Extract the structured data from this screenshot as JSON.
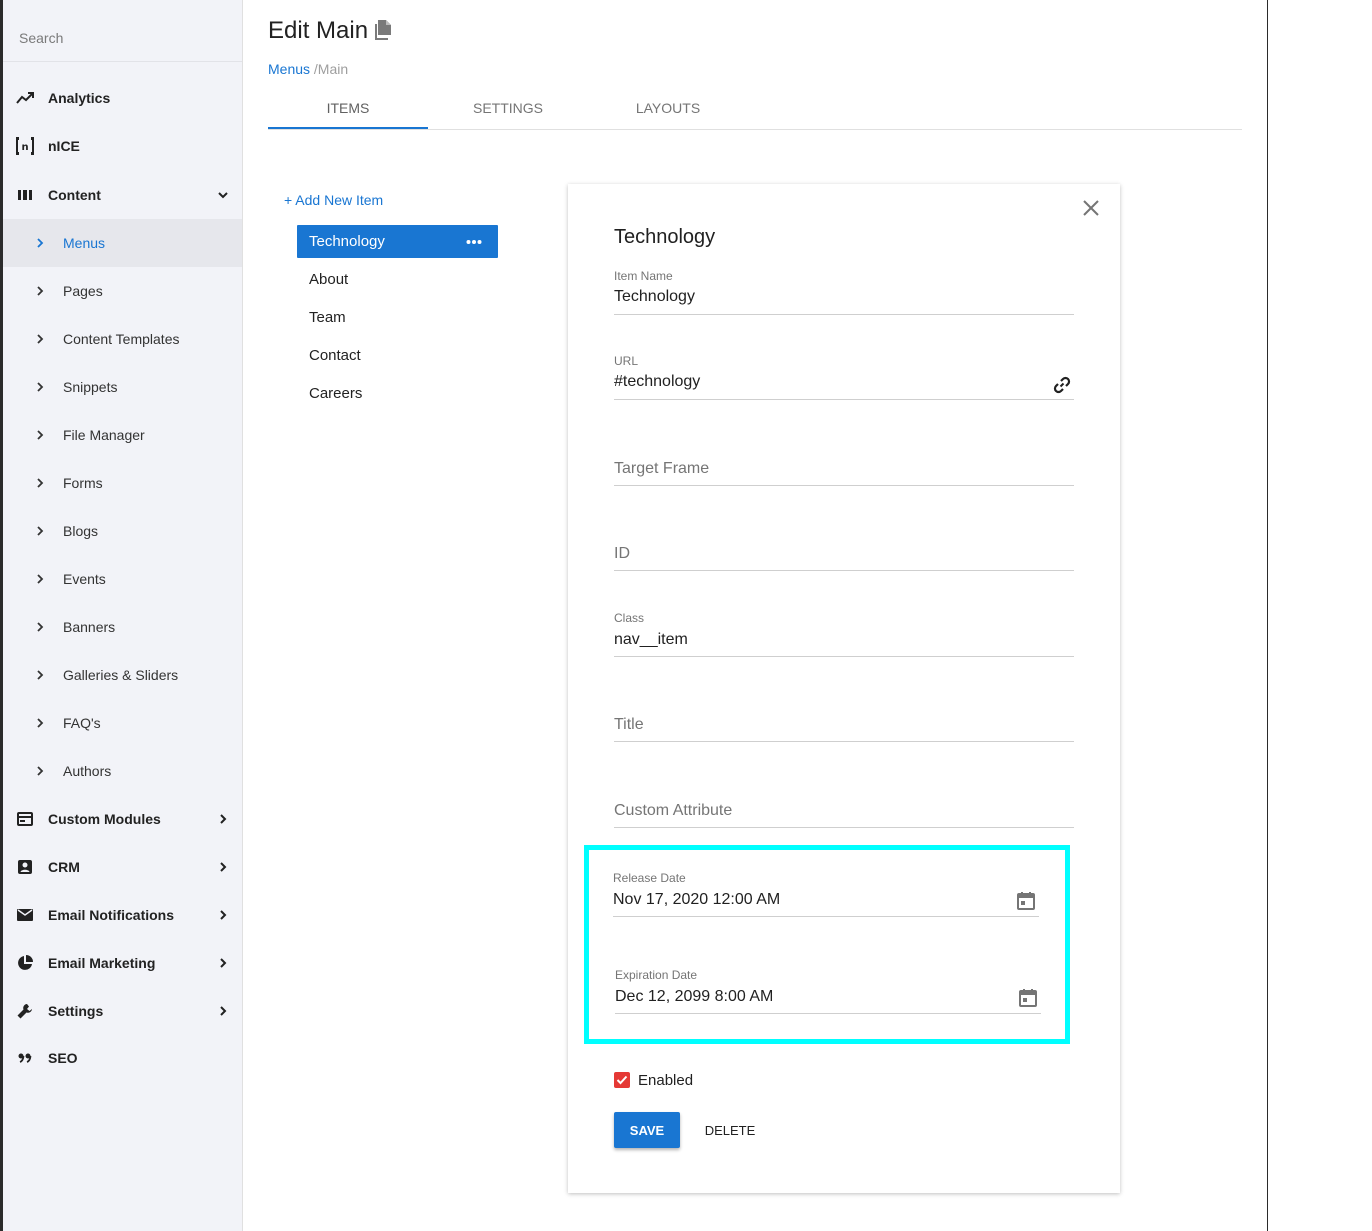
{
  "sidebar": {
    "search_placeholder": "Search",
    "items": [
      {
        "label": "Analytics",
        "icon": "trending-up-icon"
      },
      {
        "label": "nICE",
        "icon": "nice-bracket-icon"
      },
      {
        "label": "Content",
        "icon": "columns-icon",
        "expanded": true
      },
      {
        "label": "Custom Modules",
        "icon": "card-icon"
      },
      {
        "label": "CRM",
        "icon": "contact-icon"
      },
      {
        "label": "Email Notifications",
        "icon": "mail-icon"
      },
      {
        "label": "Email Marketing",
        "icon": "pie-chart-icon"
      },
      {
        "label": "Settings",
        "icon": "wrench-icon"
      },
      {
        "label": "SEO",
        "icon": "quote-icon"
      }
    ],
    "content_subitems": [
      {
        "label": "Menus",
        "active": true
      },
      {
        "label": "Pages"
      },
      {
        "label": "Content Templates"
      },
      {
        "label": "Snippets"
      },
      {
        "label": "File Manager"
      },
      {
        "label": "Forms"
      },
      {
        "label": "Blogs"
      },
      {
        "label": "Events"
      },
      {
        "label": "Banners"
      },
      {
        "label": "Galleries & Sliders"
      },
      {
        "label": "FAQ's"
      },
      {
        "label": "Authors"
      }
    ]
  },
  "header": {
    "title": "Edit Main",
    "breadcrumb_link": "Menus",
    "breadcrumb_current": "/Main"
  },
  "tabs": [
    {
      "label": "ITEMS",
      "active": true
    },
    {
      "label": "SETTINGS"
    },
    {
      "label": "LAYOUTS"
    }
  ],
  "menu_list": {
    "add_label": "+ Add New Item",
    "items": [
      {
        "label": "Technology",
        "active": true
      },
      {
        "label": "About"
      },
      {
        "label": "Team"
      },
      {
        "label": "Contact"
      },
      {
        "label": "Careers"
      }
    ]
  },
  "editor": {
    "title": "Technology",
    "item_name": {
      "label": "Item Name",
      "value": "Technology"
    },
    "url": {
      "label": "URL",
      "value": "#technology"
    },
    "target_frame": {
      "placeholder": "Target Frame"
    },
    "id_field": {
      "placeholder": "ID"
    },
    "class_field": {
      "label": "Class",
      "value": "nav__item"
    },
    "title_field": {
      "placeholder": "Title"
    },
    "custom_attribute": {
      "placeholder": "Custom Attribute"
    },
    "release_date": {
      "label": "Release Date",
      "value": "Nov 17, 2020 12:00 AM"
    },
    "expiration_date": {
      "label": "Expiration Date",
      "value": "Dec 12, 2099 8:00 AM"
    },
    "enabled_label": "Enabled",
    "enabled": true,
    "save_label": "SAVE",
    "delete_label": "DELETE"
  },
  "colors": {
    "accent": "#1976d2",
    "highlight": "#00ffff",
    "checkbox": "#e53935"
  }
}
